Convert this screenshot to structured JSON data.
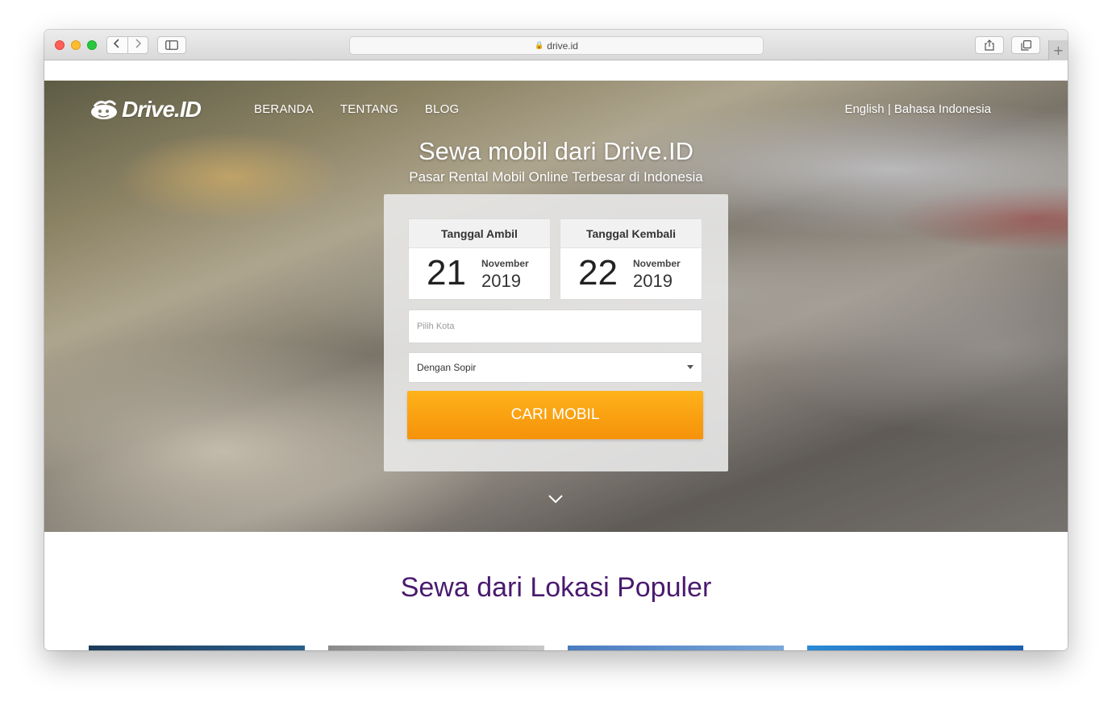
{
  "browser": {
    "url": "drive.id",
    "back_icon": "chevron-left-icon",
    "forward_icon": "chevron-right-icon",
    "sidebar_icon": "sidebar-icon",
    "share_icon": "share-icon",
    "tabs_icon": "tabs-icon",
    "new_tab_label": "+"
  },
  "header": {
    "logo_text": "Drive.ID",
    "nav": [
      "BERANDA",
      "TENTANG",
      "BLOG"
    ],
    "lang": {
      "english": "English",
      "separator": " | ",
      "indonesia": "Bahasa Indonesia"
    }
  },
  "hero": {
    "title": "Sewa mobil dari Drive.ID",
    "subtitle": "Pasar Rental Mobil Online Terbesar di Indonesia"
  },
  "search": {
    "pickup": {
      "label": "Tanggal Ambil",
      "day": "21",
      "month": "November",
      "year": "2019"
    },
    "return": {
      "label": "Tanggal Kembali",
      "day": "22",
      "month": "November",
      "year": "2019"
    },
    "city_placeholder": "Pilih Kota",
    "driver_option": "Dengan Sopir",
    "submit_label": "CARI MOBIL"
  },
  "popular": {
    "title": "Sewa dari Lokasi Populer"
  },
  "colors": {
    "accent": "#f5920a",
    "title_purple": "#4a1a6e"
  }
}
